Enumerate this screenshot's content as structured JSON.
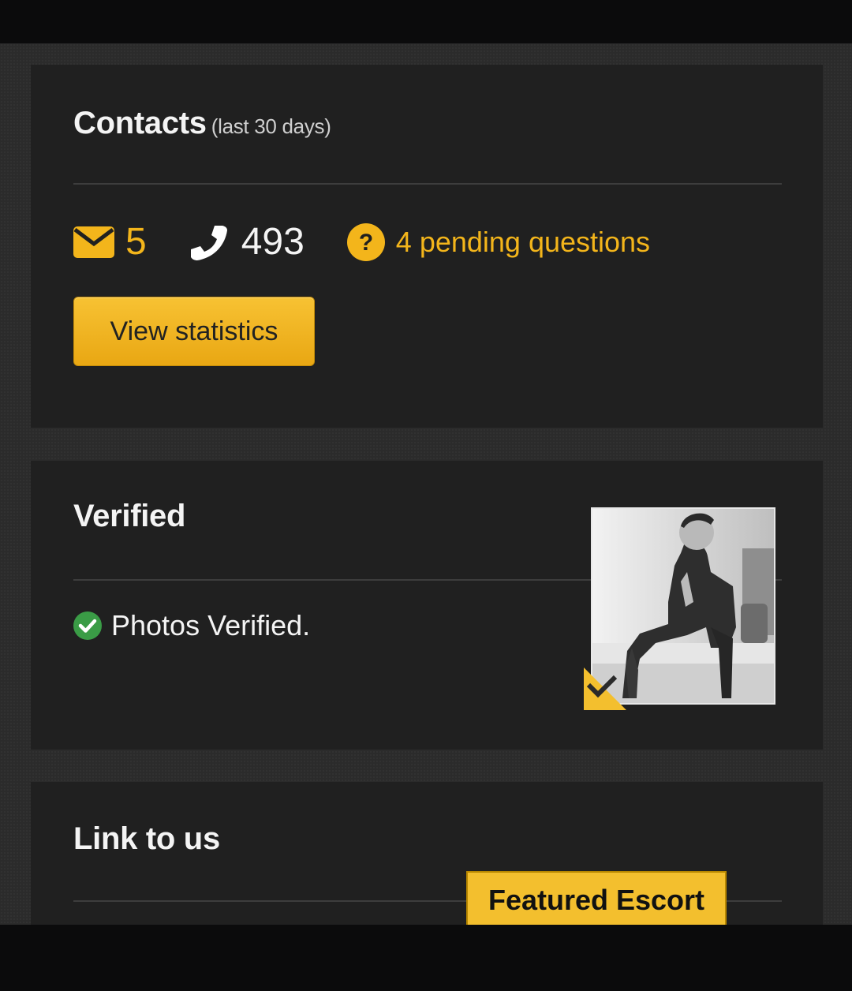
{
  "colors": {
    "accent": "#f3b51b",
    "background": "#2b2b2b",
    "card": "#202020",
    "verified_green": "#3a9c46"
  },
  "contacts": {
    "title": "Contacts",
    "subtitle": "(last 30 days)",
    "mail_icon": "envelope-icon",
    "mail_count": "5",
    "phone_icon": "phone-icon",
    "call_count": "493",
    "question_icon": "question-circle-icon",
    "pending_text": "4 pending questions",
    "view_button": "View statistics"
  },
  "verified": {
    "title": "Verified",
    "check_icon": "check-circle-icon",
    "status_text": "Photos Verified.",
    "photo": "verified-profile-photo",
    "corner_icon": "checkmark-icon"
  },
  "link": {
    "title": "Link to us",
    "badge_text": "Featured Escort"
  }
}
